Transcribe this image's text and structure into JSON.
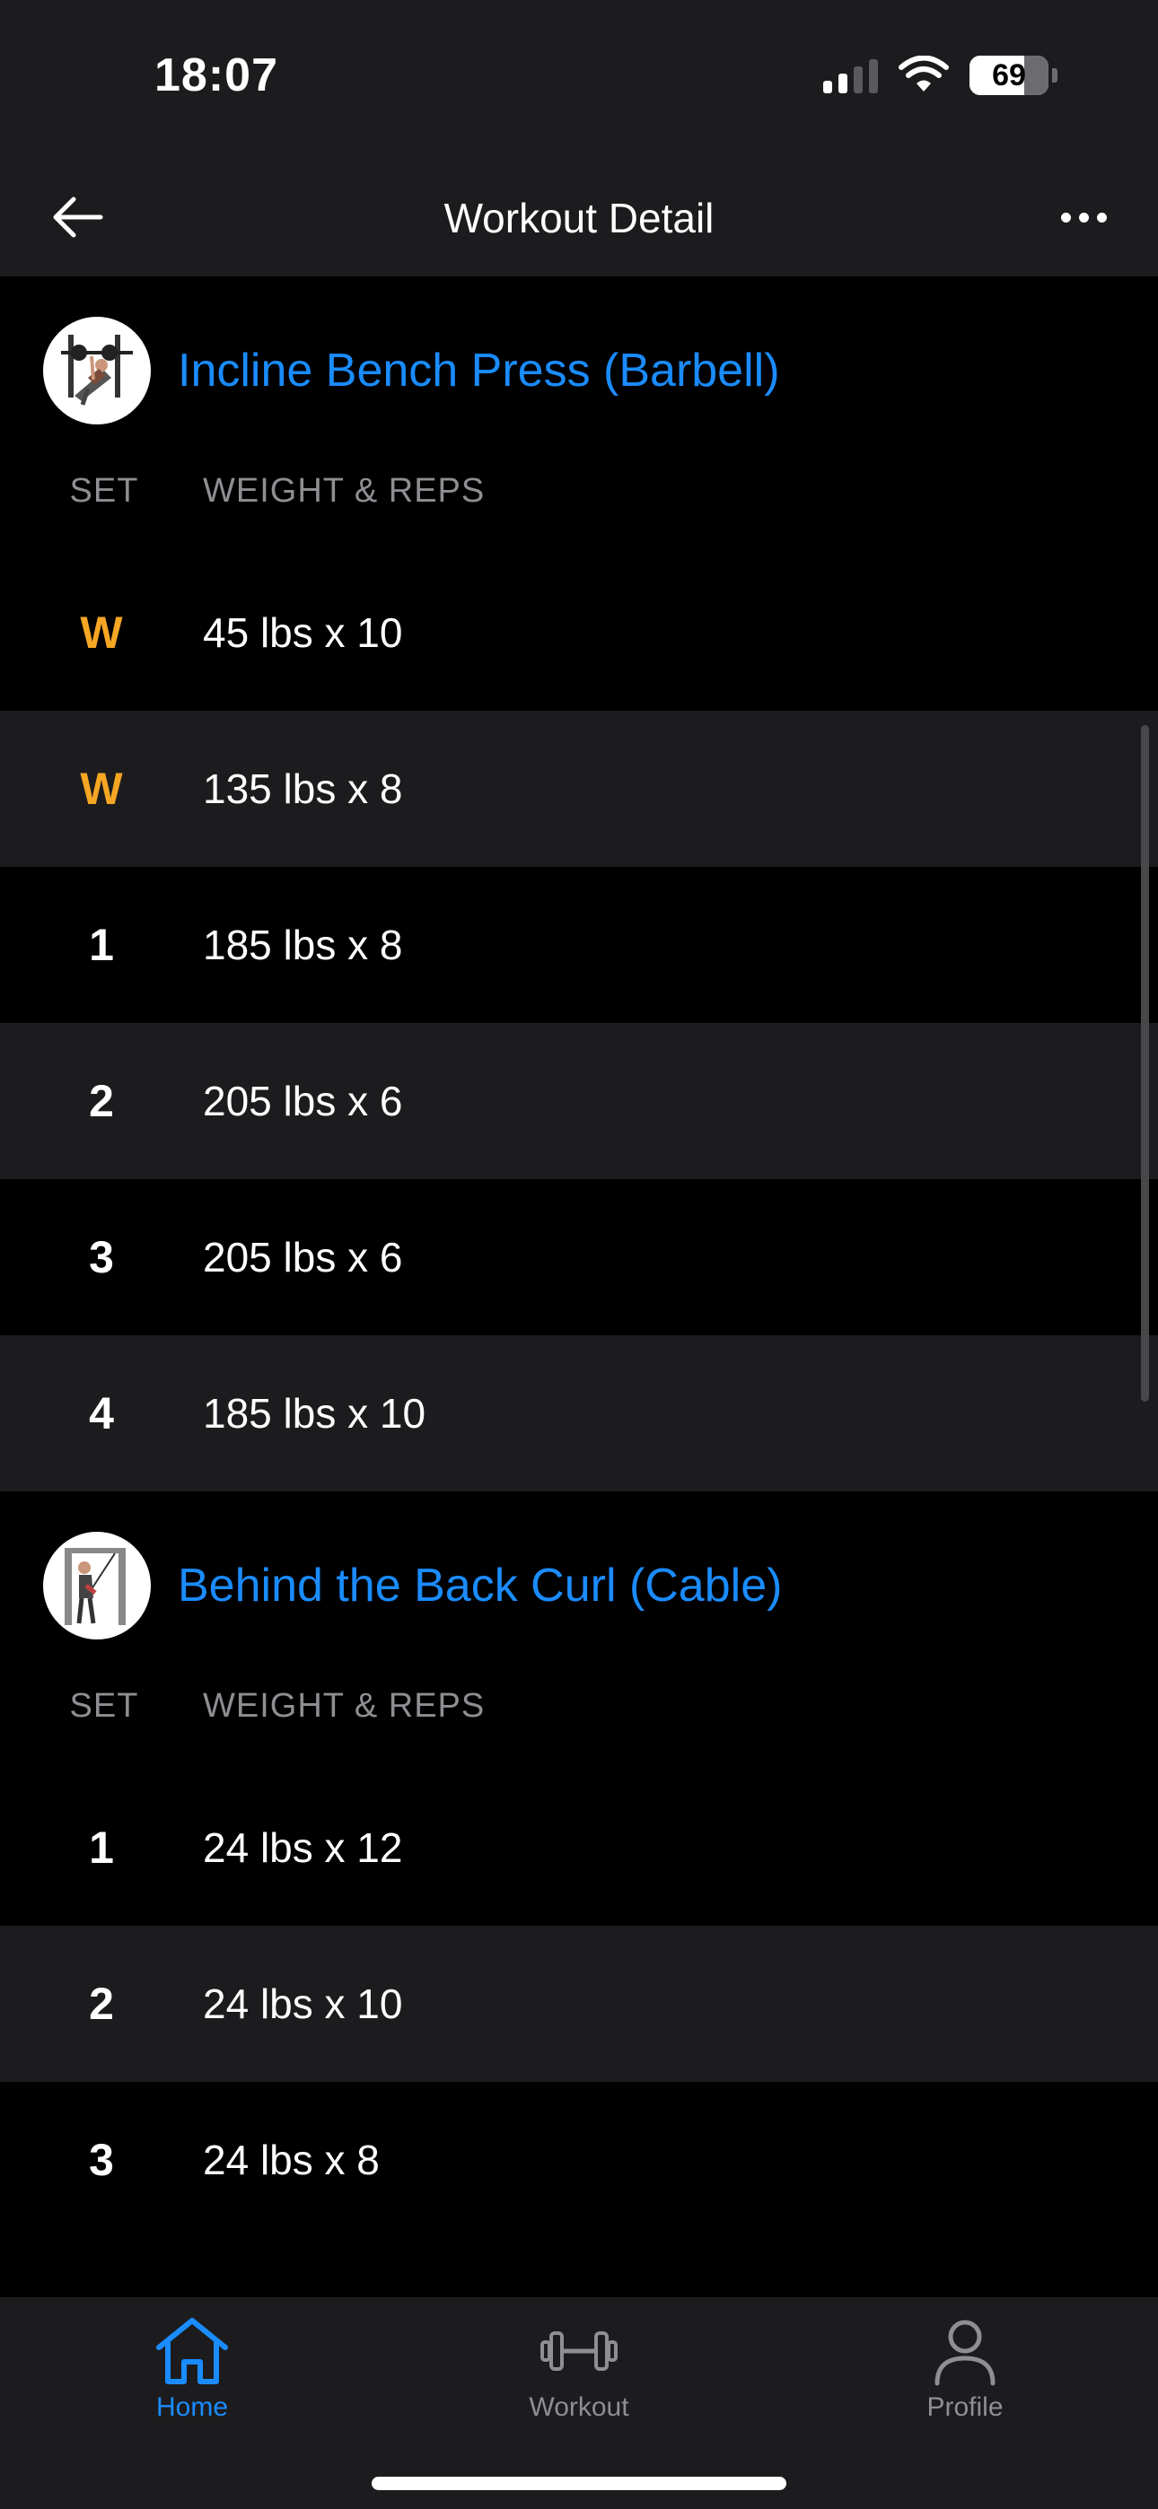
{
  "status_bar": {
    "time": "18:07",
    "battery": "69"
  },
  "nav": {
    "title": "Workout Detail"
  },
  "exercises": [
    {
      "name": "Incline Bench Press (Barbell)",
      "set_header": "SET",
      "weight_reps_header": "WEIGHT & REPS",
      "sets": [
        {
          "set": "W",
          "value": "45 lbs x 10"
        },
        {
          "set": "W",
          "value": "135 lbs x 8"
        },
        {
          "set": "1",
          "value": "185 lbs x 8"
        },
        {
          "set": "2",
          "value": "205 lbs x 6"
        },
        {
          "set": "3",
          "value": "205 lbs x 6"
        },
        {
          "set": "4",
          "value": "185 lbs x 10"
        }
      ]
    },
    {
      "name": "Behind the Back Curl (Cable)",
      "set_header": "SET",
      "weight_reps_header": "WEIGHT & REPS",
      "sets": [
        {
          "set": "1",
          "value": "24 lbs x 12"
        },
        {
          "set": "2",
          "value": "24 lbs x 10"
        },
        {
          "set": "3",
          "value": "24 lbs x 8"
        }
      ]
    }
  ],
  "tabs": [
    {
      "label": "Home",
      "icon": "home-icon",
      "active": true
    },
    {
      "label": "Workout",
      "icon": "dumbbell-icon",
      "active": false
    },
    {
      "label": "Profile",
      "icon": "person-icon",
      "active": false
    }
  ],
  "colors": {
    "accent": "#1a8cff",
    "warmup": "#f5a623",
    "row_alt": "#1c1c1e",
    "background": "#000000"
  }
}
